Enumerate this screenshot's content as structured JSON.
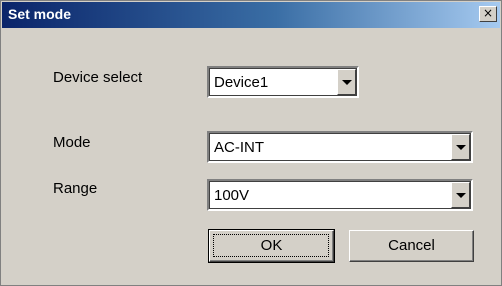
{
  "dialog": {
    "title": "Set mode",
    "close_glyph": "×",
    "icons": {
      "close": "close-icon",
      "dropdown": "chevron-down-icon"
    }
  },
  "fields": {
    "device_select": {
      "label": "Device select",
      "value": "Device1"
    },
    "mode": {
      "label": "Mode",
      "value": "AC-INT"
    },
    "range": {
      "label": "Range",
      "value": "100V"
    }
  },
  "buttons": {
    "ok": "OK",
    "cancel": "Cancel"
  }
}
